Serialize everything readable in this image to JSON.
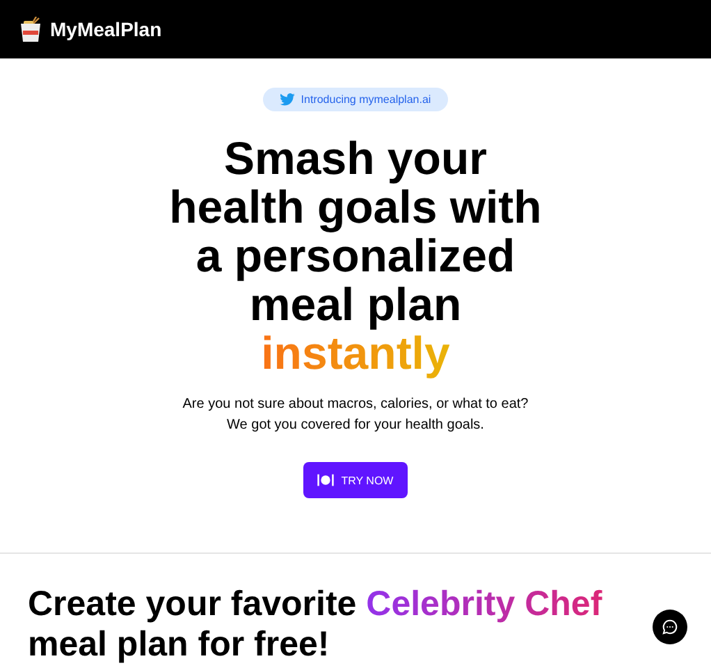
{
  "navbar": {
    "brand": "MyMealPlan"
  },
  "hero": {
    "announcement": "Introducing mymealplan.ai",
    "headline": "Smash your health goals with a personalized meal plan",
    "headline_highlight": "instantly",
    "subtitle": [
      "Are you not sure about macros, calories, or what to eat?",
      "We got you covered for your health goals."
    ],
    "cta": "TRY NOW"
  },
  "section": {
    "heading": "Create your favorite",
    "heading_highlight": "Celebrity Chef",
    "heading_rest": "meal plan for free!"
  }
}
